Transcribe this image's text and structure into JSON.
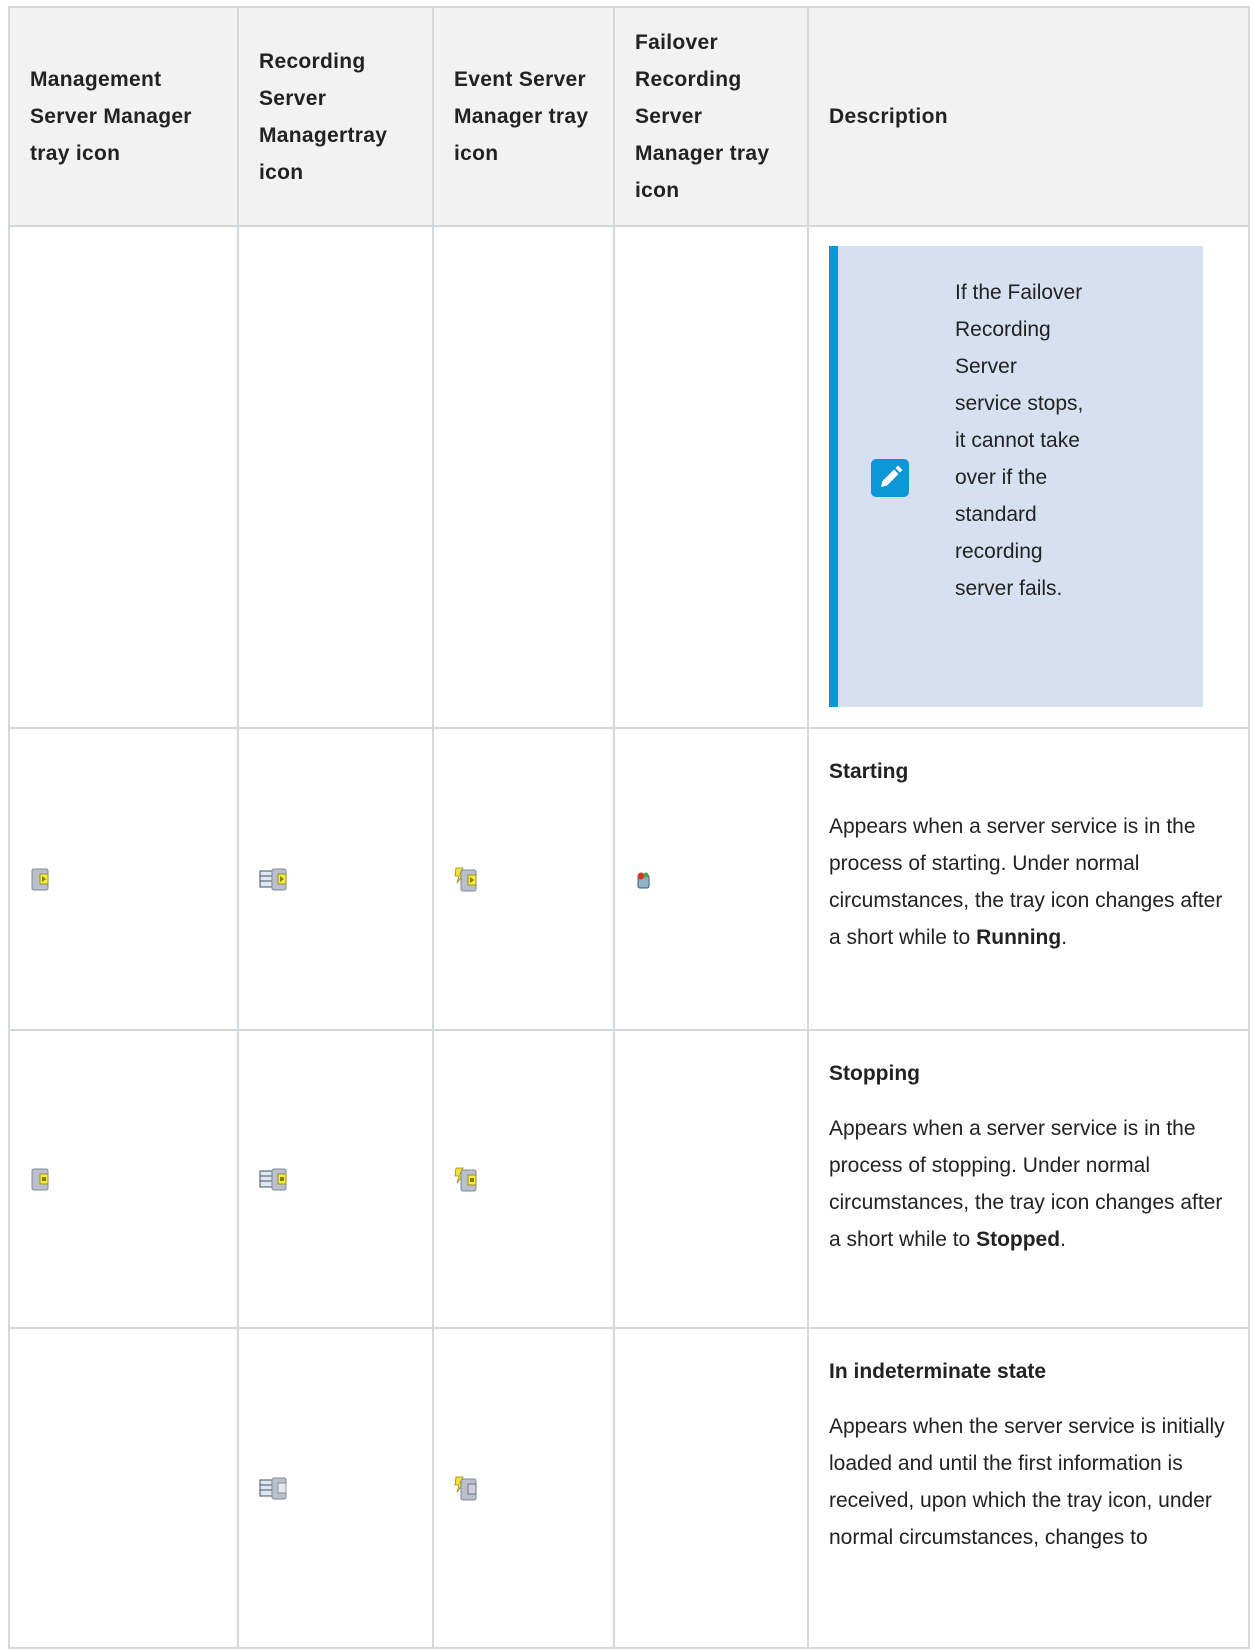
{
  "headers": {
    "col1": "Management Server Manager tray icon",
    "col2": "Recording Server Managertray icon",
    "col3": "Event Server Manager tray icon",
    "col4": "Failover Recording Server Manager tray icon",
    "col5": "Description"
  },
  "note": {
    "icon": "pencil-icon",
    "text": "If the Failover Recording Server service stops, it cannot take over if the standard recording server fails."
  },
  "rows": [
    {
      "title": "Starting",
      "body": "Appears when a server service is in the process of starting. Under normal circumstances, the tray icon changes after a short while to ",
      "body_bold": "Running",
      "body_end": ".",
      "icons": [
        "management-server-starting-icon",
        "recording-server-starting-icon",
        "event-server-starting-icon",
        "failover-server-starting-icon"
      ]
    },
    {
      "title": "Stopping",
      "body": "Appears when a server service is in the process of stopping. Under normal circumstances, the tray icon changes after a short while to ",
      "body_bold": "Stopped",
      "body_end": ".",
      "icons": [
        "management-server-stopping-icon",
        "recording-server-stopping-icon",
        "event-server-stopping-icon"
      ]
    },
    {
      "title": "In indeterminate state",
      "body": "Appears when the server service is initially loaded and until the first information is received, upon which the tray icon, under normal circumstances, changes to",
      "icons": [
        "recording-server-indeterminate-icon",
        "event-server-indeterminate-icon"
      ]
    }
  ],
  "colors": {
    "accent": "#0d97d6",
    "note_bg": "#d7e0f0",
    "header_bg": "#f2f2f2",
    "border": "#d6d9dc"
  }
}
